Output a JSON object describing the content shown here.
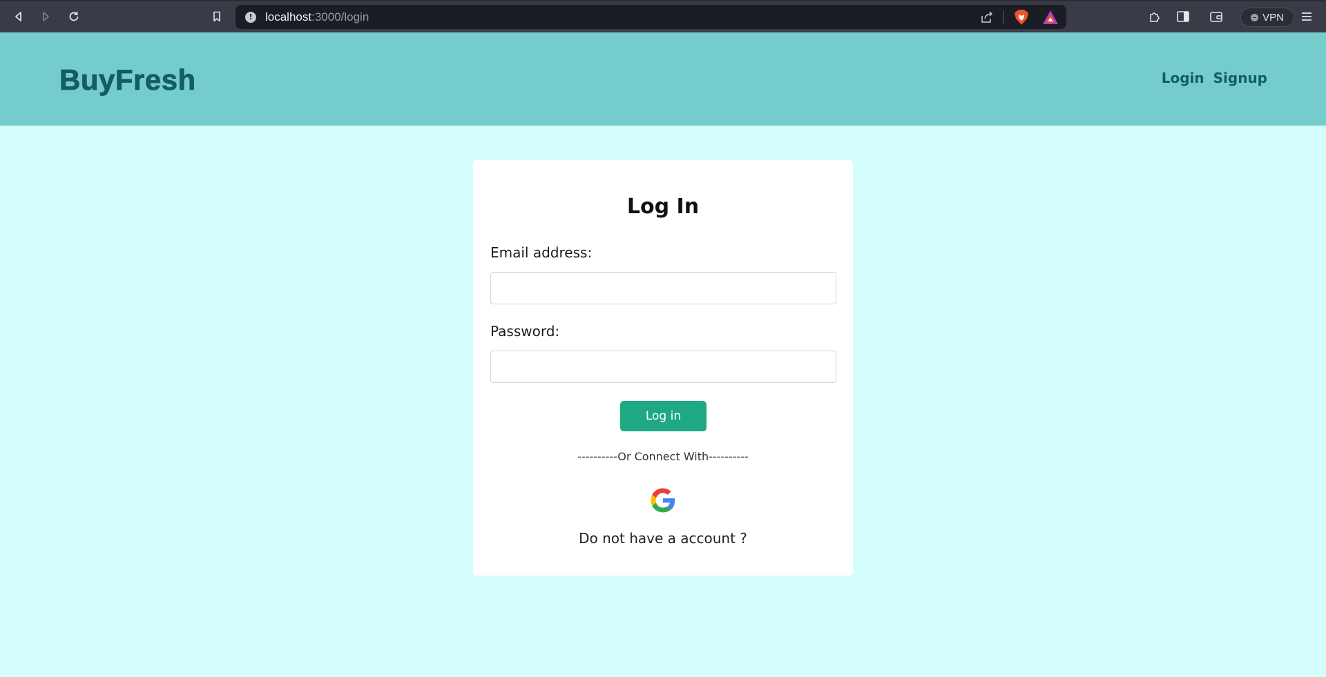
{
  "browser": {
    "url_host": "localhost",
    "url_path": ":3000/login",
    "vpn_label": "VPN"
  },
  "header": {
    "brand": "BuyFresh",
    "nav": {
      "login": "Login",
      "signup": "Signup"
    }
  },
  "login_form": {
    "title": "Log In",
    "email_label": "Email address:",
    "email_value": "",
    "password_label": "Password:",
    "password_value": "",
    "submit_label": "Log in",
    "divider": "----------Or Connect With----------",
    "signup_prompt": "Do not have a account ?"
  },
  "colors": {
    "header_bg": "#74cdcc",
    "brand_text": "#135d63",
    "page_bg": "#d4fefc",
    "button_bg": "#1ea982"
  },
  "icons": [
    "back-icon",
    "forward-icon",
    "reload-icon",
    "bookmark-icon",
    "site-info-icon",
    "share-icon",
    "brave-shields-icon",
    "brave-rewards-icon",
    "extensions-icon",
    "sidebar-icon",
    "wallet-icon",
    "menu-icon",
    "google-icon"
  ]
}
